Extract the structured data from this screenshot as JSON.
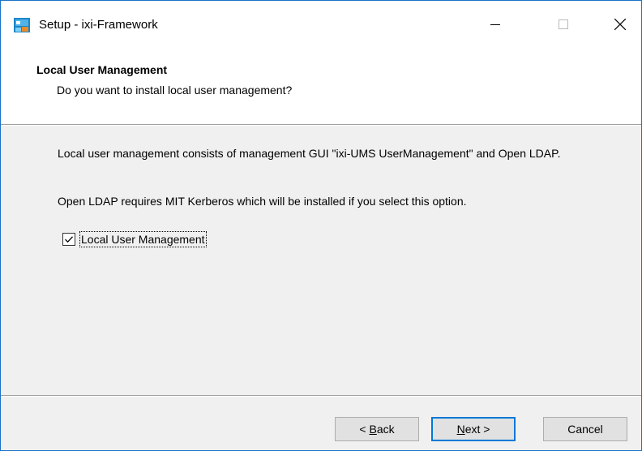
{
  "window": {
    "title": "Setup - ixi-Framework",
    "border_color": "#1a73c8",
    "icon": "installer-app-icon"
  },
  "header": {
    "title": "Local User Management",
    "subtitle": "Do you want to install local user management?"
  },
  "content": {
    "paragraph1": "Local user management consists of management GUI \"ixi-UMS UserManagement\" and Open LDAP.",
    "paragraph2": "Open LDAP requires MIT Kerberos which will be installed if you select this option.",
    "checkbox": {
      "label": "Local User Management",
      "checked": true
    }
  },
  "buttons": {
    "back_hotkey": "B",
    "back_rest": "ack",
    "back_prefix": "< ",
    "next_hotkey": "N",
    "next_rest": "ext >",
    "cancel": "Cancel",
    "accent": "#0078d7"
  }
}
